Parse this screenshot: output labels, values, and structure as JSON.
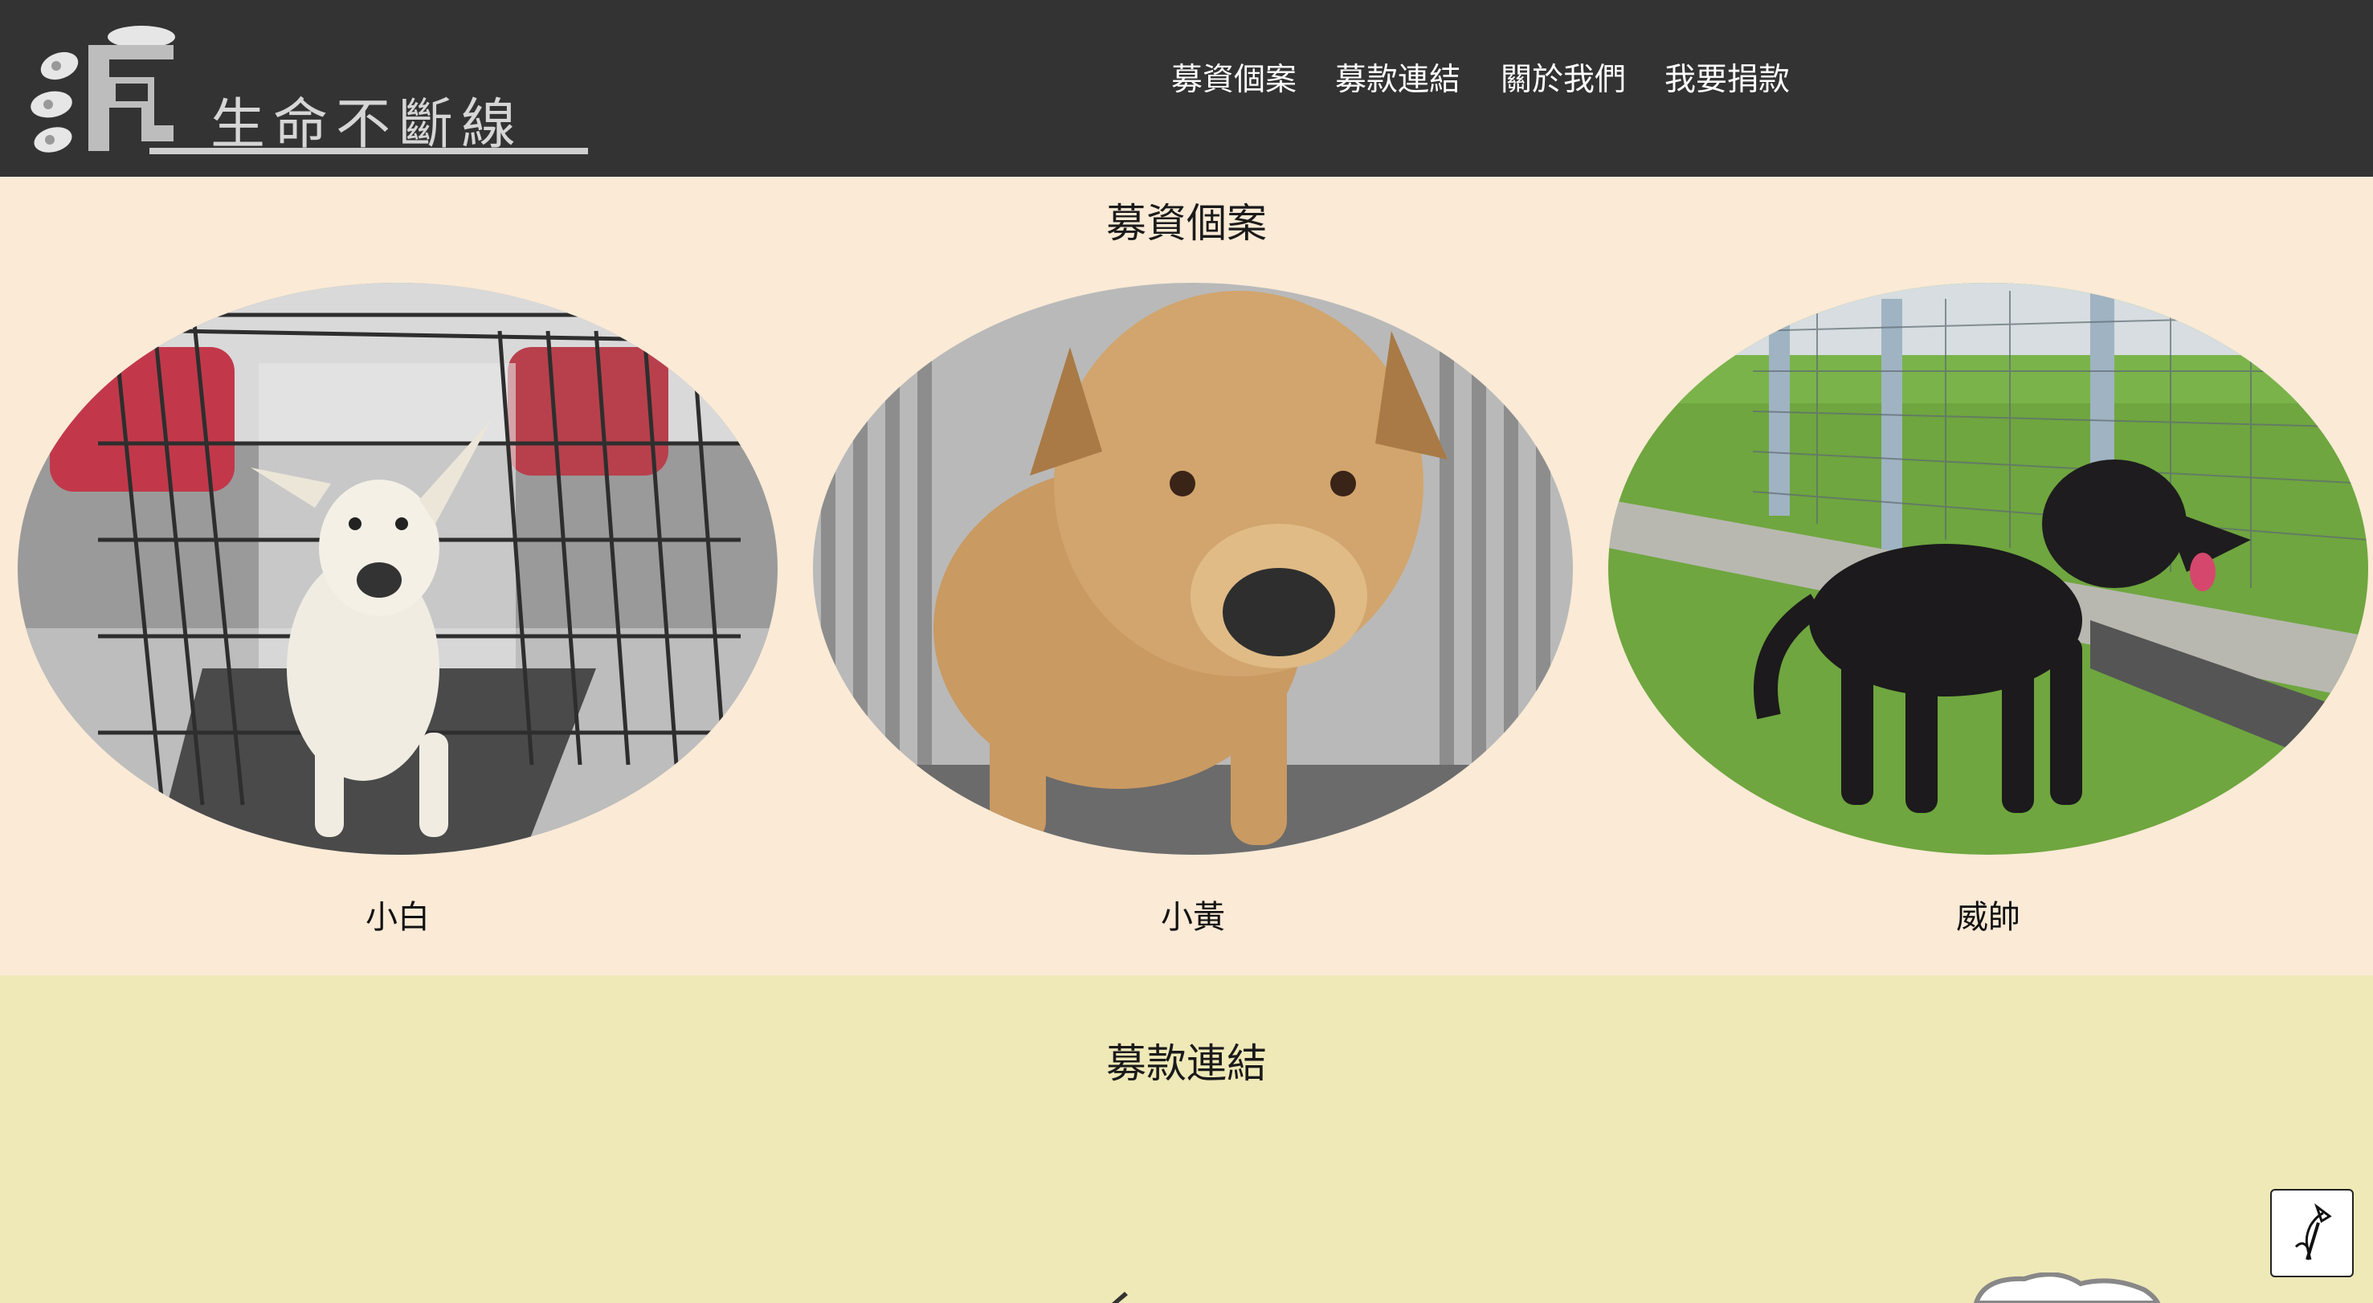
{
  "header": {
    "logo_text": "生命不斷線",
    "nav": [
      "募資個案",
      "募款連結",
      "關於我們",
      "我要捐款"
    ]
  },
  "cases": {
    "title": "募資個案",
    "items": [
      {
        "name": "小白",
        "photo": "white-dog-in-cage"
      },
      {
        "name": "小黃",
        "photo": "tan-dog-in-kennel"
      },
      {
        "name": "威帥",
        "photo": "black-dog-on-grass"
      }
    ]
  },
  "links": {
    "title": "募款連結"
  },
  "back_to_top_icon": "curved-up-arrow-icon",
  "colors": {
    "header_bg": "#333333",
    "cases_bg": "#faead6",
    "links_bg": "#efe9b8"
  }
}
